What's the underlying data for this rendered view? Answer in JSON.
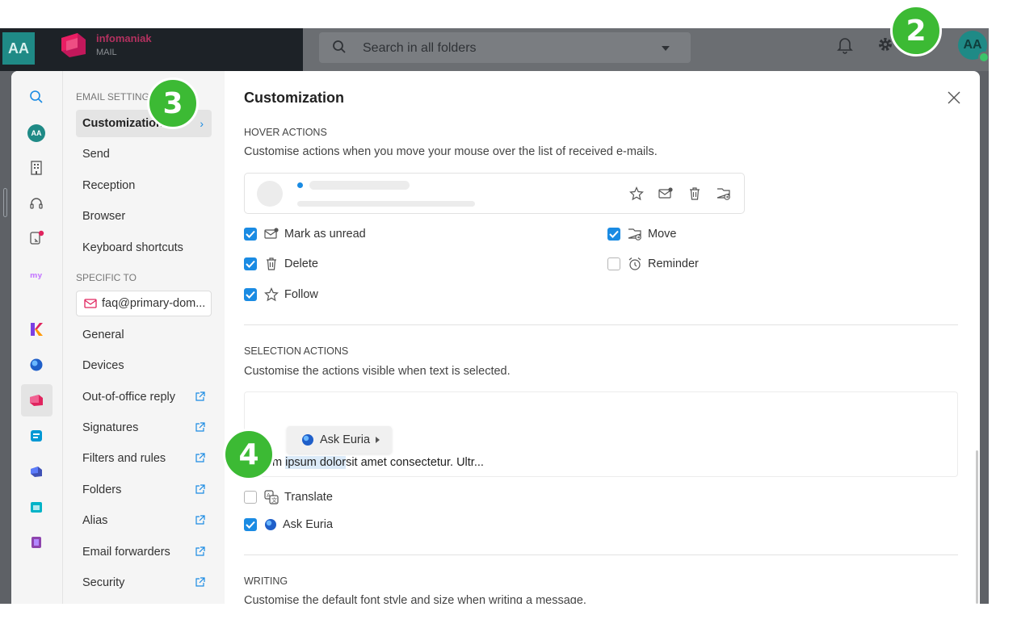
{
  "app": {
    "avatar_initials": "AA",
    "brand_name": "infomaniak",
    "brand_app": "MAIL",
    "search_placeholder": "Search in all folders",
    "user_initials": "AA"
  },
  "rail": {
    "avatar_initials": "AA",
    "icons": [
      "search-icon",
      "avatar",
      "building-icon",
      "headset-icon",
      "device-icon",
      "my-icon",
      "kchat-icon",
      "euria-icon",
      "mail-app-icon",
      "kdrive-icon",
      "swisstransfer-icon",
      "calendar-icon",
      "kmeet-icon"
    ]
  },
  "nav": {
    "header_email": "EMAIL SETTINGS",
    "items_email": [
      {
        "label": "Customization",
        "active": true
      },
      {
        "label": "Send"
      },
      {
        "label": "Reception"
      },
      {
        "label": "Browser"
      },
      {
        "label": "Keyboard shortcuts"
      }
    ],
    "header_specific": "SPECIFIC TO",
    "domain": "faq@primary-dom...",
    "items_specific": [
      {
        "label": "General"
      },
      {
        "label": "Devices"
      },
      {
        "label": "Out-of-office reply",
        "external": true
      },
      {
        "label": "Signatures",
        "external": true
      },
      {
        "label": "Filters and rules",
        "external": true
      },
      {
        "label": "Folders",
        "external": true
      },
      {
        "label": "Alias",
        "external": true
      },
      {
        "label": "Email forwarders",
        "external": true
      },
      {
        "label": "Security",
        "external": true
      }
    ]
  },
  "content": {
    "title": "Customization",
    "hover": {
      "heading": "HOVER ACTIONS",
      "description": "Customise actions when you move your mouse over the list of received e-mails.",
      "options": [
        {
          "label": "Mark as unread",
          "checked": true,
          "icon": "envelope-dot-icon"
        },
        {
          "label": "Move",
          "checked": true,
          "icon": "folder-move-icon"
        },
        {
          "label": "Delete",
          "checked": true,
          "icon": "trash-icon"
        },
        {
          "label": "Reminder",
          "checked": false,
          "icon": "alarm-icon"
        },
        {
          "label": "Follow",
          "checked": true,
          "icon": "star-icon"
        }
      ]
    },
    "selection": {
      "heading": "SELECTION ACTIONS",
      "description": "Customise the actions visible when text is selected.",
      "popup_label": "Ask Euria",
      "sample_pre": "m ",
      "sample_highlight": "ipsum dolor",
      "sample_post": "sit amet consectetur. Ultr...",
      "options": [
        {
          "label": "Translate",
          "checked": false,
          "icon": "translate-icon"
        },
        {
          "label": "Ask Euria",
          "checked": true,
          "icon": "euria-icon"
        }
      ]
    },
    "writing": {
      "heading": "WRITING",
      "description": "Customise the default font style and size when writing a message."
    }
  },
  "badges": [
    "2",
    "3",
    "4"
  ],
  "colors": {
    "accent": "#1a8be3",
    "badge": "#3cba34",
    "brand": "#e0245e"
  }
}
